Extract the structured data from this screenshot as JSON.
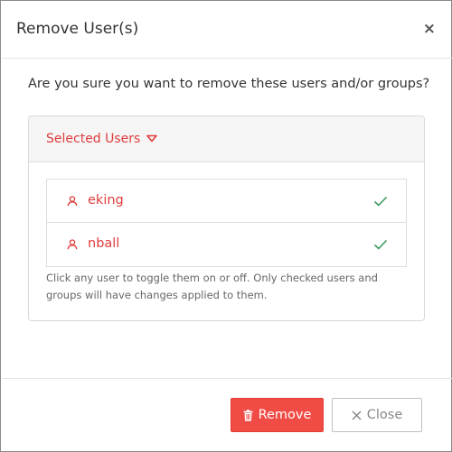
{
  "dialog": {
    "title": "Remove User(s)",
    "close_icon": "×",
    "question": "Are you sure you want to remove these users and/or groups?"
  },
  "panel": {
    "heading": "Selected Users",
    "caret_icon": "caret-down-icon",
    "users": [
      {
        "name": "eking",
        "checked": true,
        "icon": "user-icon",
        "check": "check-icon"
      },
      {
        "name": "nball",
        "checked": true,
        "icon": "user-icon",
        "check": "check-icon"
      }
    ],
    "help_text": "Click any user to toggle them on or off. Only checked users and groups will have changes applied to them."
  },
  "footer": {
    "remove_label": "Remove",
    "remove_icon": "trash-icon",
    "close_label": "Close",
    "close_icon": "x-icon"
  },
  "colors": {
    "accent": "#e03c3c",
    "danger_button": "#f04b45",
    "check": "#3c9a5f"
  }
}
